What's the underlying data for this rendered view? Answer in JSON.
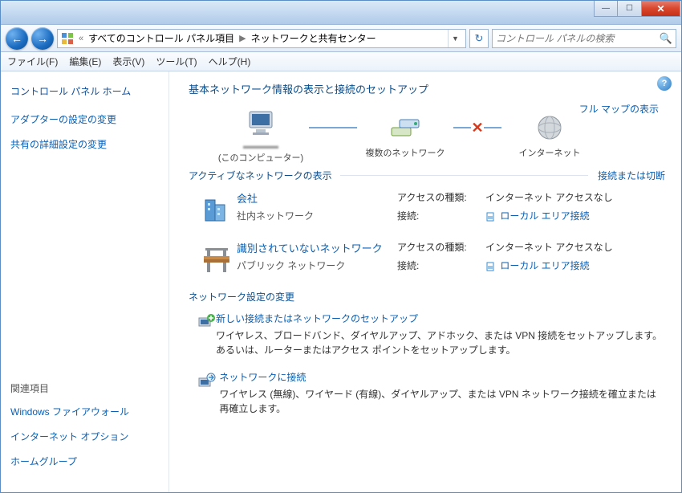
{
  "titlebar": {
    "minimize": "—",
    "maximize": "☐",
    "close": "✕"
  },
  "nav": {
    "back": "←",
    "forward": "→",
    "breadcrumb": {
      "prefix": "«",
      "item1": "すべてのコントロール パネル項目",
      "item2": "ネットワークと共有センター",
      "sep": "▶"
    },
    "refresh": "↻",
    "search_placeholder": "コントロール パネルの検索"
  },
  "menu": {
    "file": "ファイル(F)",
    "edit": "編集(E)",
    "view": "表示(V)",
    "tools": "ツール(T)",
    "help": "ヘルプ(H)"
  },
  "sidebar": {
    "home": "コントロール パネル ホーム",
    "link1": "アダプターの設定の変更",
    "link2": "共有の詳細設定の変更",
    "related_title": "関連項目",
    "rel1": "Windows ファイアウォール",
    "rel2": "インターネット オプション",
    "rel3": "ホームグループ"
  },
  "content": {
    "help": "?",
    "heading": "基本ネットワーク情報の表示と接続のセットアップ",
    "fullmap": "フル マップの表示",
    "netmap": {
      "node1_sub": "(このコンピューター)",
      "node2": "複数のネットワーク",
      "node3": "インターネット"
    },
    "active_heading": "アクティブなネットワークの表示",
    "connect_link": "接続または切断",
    "net1": {
      "title": "会社",
      "subtitle": "社内ネットワーク",
      "access_k": "アクセスの種類:",
      "access_v": "インターネット アクセスなし",
      "conn_k": "接続:",
      "conn_v": "ローカル エリア接続"
    },
    "net2": {
      "title": "識別されていないネットワーク",
      "subtitle": "パブリック ネットワーク",
      "access_k": "アクセスの種類:",
      "access_v": "インターネット アクセスなし",
      "conn_k": "接続:",
      "conn_v": "ローカル エリア接続"
    },
    "settings_heading": "ネットワーク設定の変更",
    "task1": {
      "link": "新しい接続またはネットワークのセットアップ",
      "desc": "ワイヤレス、ブロードバンド、ダイヤルアップ、アドホック、または VPN 接続をセットアップします。あるいは、ルーターまたはアクセス ポイントをセットアップします。"
    },
    "task2": {
      "link": "ネットワークに接続",
      "desc": "ワイヤレス (無線)、ワイヤード (有線)、ダイヤルアップ、または VPN ネットワーク接続を確立または再確立します。"
    }
  }
}
